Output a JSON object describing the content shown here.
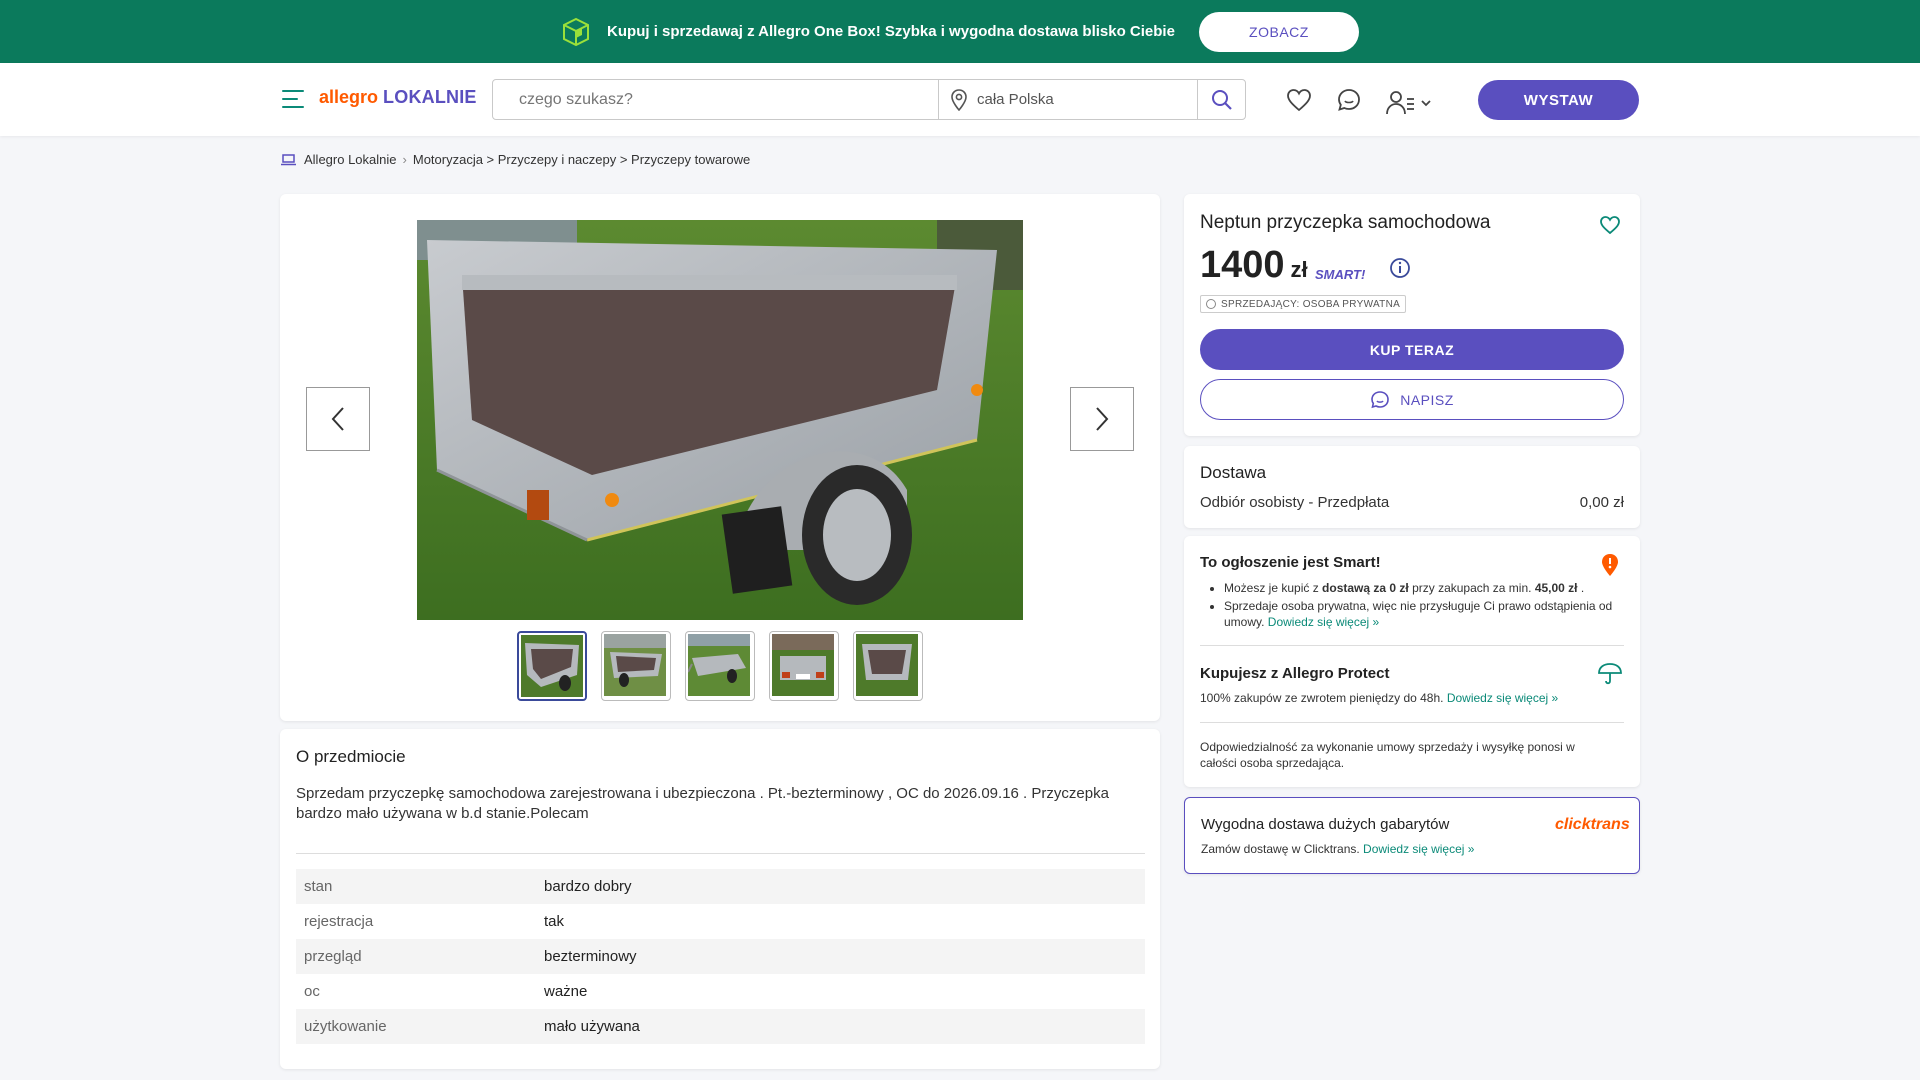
{
  "promo": {
    "text": "Kupuj i sprzedawaj z Allegro One Box! Szybka i wygodna dostawa blisko Ciebie",
    "button": "ZOBACZ"
  },
  "header": {
    "logo_a": "allegro",
    "logo_b": "LOKALNIE",
    "search_placeholder": "czego szukasz?",
    "location": "cała Polska",
    "post_button": "WYSTAW"
  },
  "breadcrumb": [
    "Allegro Lokalnie",
    "Motoryzacja > Przyczepy i naczepy > Przyczepy towarowe"
  ],
  "gallery": {
    "thumbnail_count": 5,
    "active_index": 0
  },
  "about": {
    "title": "O przedmiocie",
    "description": "Sprzedam przyczepkę samochodowa zarejestrowana i ubezpieczona . Pt.-bezterminowy , OC do 2026.09.16 . Przyczepka bardzo mało używana w b.d stanie.Polecam",
    "params": [
      {
        "key": "stan",
        "value": "bardzo dobry"
      },
      {
        "key": "rejestracja",
        "value": "tak"
      },
      {
        "key": "przegląd",
        "value": "bezterminowy"
      },
      {
        "key": "oc",
        "value": "ważne"
      },
      {
        "key": "użytkowanie",
        "value": "mało używana"
      }
    ]
  },
  "offer": {
    "title": "Neptun przyczepka samochodowa",
    "price": "1400",
    "currency": "zł",
    "smart": "SMART!",
    "seller_badge": "SPRZEDAJĄCY: OSOBA PRYWATNA",
    "buy_button": "KUP TERAZ",
    "write_button": "NAPISZ"
  },
  "delivery": {
    "title": "Dostawa",
    "method": "Odbiór osobisty - Przedpłata",
    "cost": "0,00 zł"
  },
  "smart_info": {
    "title": "To ogłoszenie jest Smart!",
    "b1_pre": "Możesz je kupić z ",
    "b1_bold": "dostawą za 0 zł",
    "b1_mid": " przy zakupach za min. ",
    "b1_amount": "45,00 zł",
    "b1_end": " .",
    "b2": "Sprzedaje osoba prywatna, więc nie przysługuje Ci prawo odstąpienia od umowy. ",
    "more": "Dowiedz się więcej »",
    "protect_title": "Kupujesz z Allegro Protect",
    "protect_text": "100% zakupów ze zwrotem pieniędzy do 48h. ",
    "responsibility": "Odpowiedzialność za wykonanie umowy sprzedaży i wysyłkę ponosi w całości osoba sprzedająca."
  },
  "clicktrans": {
    "title": "Wygodna dostawa dużych gabarytów",
    "logo": "clicktrans",
    "text": "Zamów dostawę w Clicktrans. ",
    "more": "Dowiedz się więcej »"
  },
  "colors": {
    "promo_bg": "#0b7a5c",
    "accent": "#5a4fbf",
    "link": "#0b8a78",
    "orange": "#ff5a00"
  }
}
